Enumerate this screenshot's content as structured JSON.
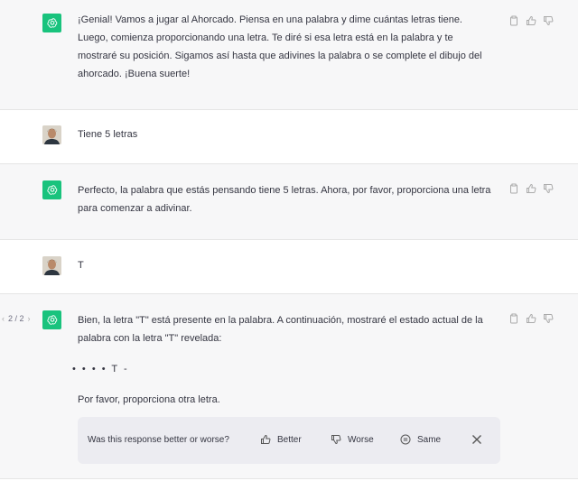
{
  "conversation": {
    "messages": [
      {
        "role": "assistant",
        "text": "¡Genial! Vamos a jugar al Ahorcado. Piensa en una palabra y dime cuántas letras tiene. Luego, comienza proporcionando una letra. Te diré si esa letra está en la palabra y te mostraré su posición. Sigamos así hasta que adivines la palabra o se complete el dibujo del ahorcado. ¡Buena suerte!"
      },
      {
        "role": "user",
        "text": "Tiene 5 letras"
      },
      {
        "role": "assistant",
        "text": "Perfecto, la palabra que estás pensando tiene 5 letras. Ahora, por favor, proporciona una letra para comenzar a adivinar."
      },
      {
        "role": "user",
        "text": "T"
      },
      {
        "role": "assistant",
        "pager": "2 / 2",
        "text": "Bien, la letra \"T\" está presente en la palabra. A continuación, mostraré el estado actual de la palabra con la letra \"T\" revelada:",
        "word_state": "• • • • T -",
        "followup": "Por favor, proporciona otra letra."
      }
    ]
  },
  "feedback": {
    "question": "Was this response better or worse?",
    "better_label": "Better",
    "worse_label": "Worse",
    "same_label": "Same"
  },
  "icons": {
    "copy": "clipboard-icon",
    "like": "thumbs-up-icon",
    "dislike": "thumbs-down-icon",
    "close": "close-icon"
  },
  "colors": {
    "assistant_bg": "#f7f7f8",
    "gpt_avatar": "#19c37d",
    "text": "#343541"
  }
}
